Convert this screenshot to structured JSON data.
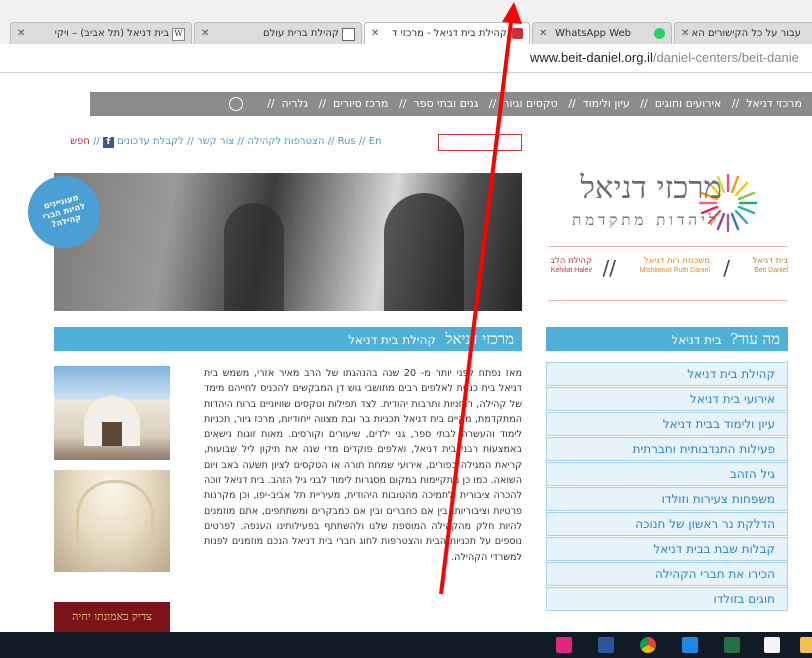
{
  "browser": {
    "tabs": [
      {
        "title": "בית דניאל (תל אביב) – ויקי",
        "active": false
      },
      {
        "title": "קהילת ברית עולם",
        "active": false
      },
      {
        "title": "קהילת בית דניאל - מרכזי ד",
        "active": true
      },
      {
        "title": "WhatsApp Web",
        "active": false
      },
      {
        "title": "עבור על כל הקישורים הא",
        "active": false
      }
    ],
    "url_host": "www.beit-daniel.org.il",
    "url_path": "/daniel-centers/beit-danie"
  },
  "nav": {
    "items": [
      "מרכזי דניאל",
      "אירועים וחוגים",
      "עיון ולימוד",
      "טקסים וגיור",
      "גנים ובתי ספר",
      "מרכז סיורים",
      "גלריה"
    ],
    "separator": "//"
  },
  "utility": {
    "search_label": "חפש",
    "items": [
      "לקבלת עדכונים",
      "צור קשר",
      "הצטרפות לקהילה",
      "En",
      "Rus"
    ],
    "separator": "//",
    "fb_letter": "f"
  },
  "hero": {
    "badge_text": "מעוניינים להיות חברי קהילה?"
  },
  "logo": {
    "title": "מרכזי דניאל",
    "subtitle": "ליהדות מתקדמת"
  },
  "centers": [
    {
      "he": "בית דניאל",
      "en": "Beit Daniel"
    },
    {
      "he": "משכנות רות דניאל",
      "en": "Mishkenot Ruth Daniel"
    },
    {
      "he": "קהילת הלב",
      "en": "Kehilat Halev"
    }
  ],
  "content": {
    "header_big": "מרכזי דניאל",
    "header_small": "קהילת בית דניאל",
    "body": "מאז נפתח לפני יותר מ- 20 שנה בהנהגתו של הרב מאיר אזרי, משמש בית דניאל בית כנסת לאלפים רבים מתושבי גוש דן המבקשים להכניס לחייהם מימד של קהילה, רוחניות ותרבות יהודית. לצד תפילות וטקסים שוויוניים ברוח היהדות המתקדמת, מקיים בית דניאל תכניות בר ובת מצווה ייחודיות, מרכז גיור, תכניות לימוד והעשרה לבתי ספר, גני ילדים, שיעורים וקורסים. מאות זוגות נישאים באמצעות רבני בית דניאל, ואלפים פוקדים מדי שנה את תיקון ליל שבועות, קריאת המגילה בפורים, אירועי שמחת תורה או הטקסים לציון תשעה באב ויום השואה. כמו כן מתקיימות במקום מסגרות לימוד לבני גיל הזהב. בית דניאל זוכה להכרה ציבורית ולתמיכה מהטובות היהודית, מעיריית תל אביב-יפו, וכן מקרנות פרטיות וציבוריות. בין אם כחברים ובין אם כמבקרים ומשתתפים, אתם מוזמנים להיות חלק מהקהילה המוספת שלנו ולהשתתף בפעילותינו הענפה. לפרטים נוספים על תכניות הבית והצטרפות לחוג חברי בית דניאל הנכם מוזמנים לפנות למשרדי הקהילה.",
    "sign_text": "צדיק באמונתו יחיה"
  },
  "sidebar": {
    "header_big": "מה עוד?",
    "header_small": "בית דניאל",
    "items": [
      "קהילת בית דניאל",
      "אירועי בית דניאל",
      "עיון ולימוד בבית דניאל",
      "פעילות התנדבותית וחברתית",
      "גיל הזהב",
      "משפחות צעירות וזולדו",
      "הדלקת נר ראשון של חנוכה",
      "קבלות שבת בבית דניאל",
      "הכירו את חברי הקהילה",
      "חוגים בזולדו"
    ]
  },
  "colors": {
    "accent": "#4fb0d8",
    "nav_gray": "#8c8c8c",
    "annotation_arrow": "#ff0000",
    "brand_red": "#c8323c"
  },
  "taskbar": {
    "icons": [
      "indesign-icon",
      "word-icon",
      "chrome-icon",
      "media-icon",
      "excel-icon",
      "store-icon",
      "folder-icon"
    ]
  }
}
